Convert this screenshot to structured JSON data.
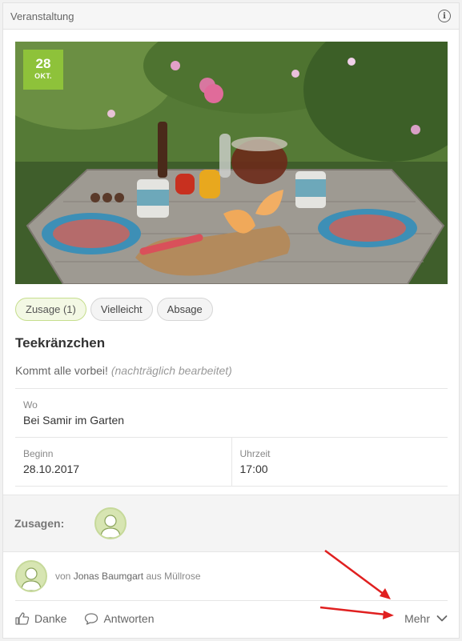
{
  "header": {
    "title": "Veranstaltung",
    "info_icon": "info-icon"
  },
  "event": {
    "date_day": "28",
    "date_month": "OKT.",
    "title": "Teekränzchen",
    "description": "Kommt alle vorbei!",
    "edited_note": "(nachträglich bearbeitet)"
  },
  "rsvp": {
    "accept": "Zusage (1)",
    "maybe": "Vielleicht",
    "decline": "Absage"
  },
  "details": {
    "where_label": "Wo",
    "where_value": "Bei Samir im Garten",
    "start_label": "Beginn",
    "start_value": "28.10.2017",
    "time_label": "Uhrzeit",
    "time_value": "17:00"
  },
  "accepts": {
    "label": "Zusagen:"
  },
  "author": {
    "prefix": "von",
    "name": "Jonas Baumgart",
    "connector": "aus",
    "place": "Müllrose"
  },
  "actions": {
    "like": "Danke",
    "reply": "Antworten",
    "more": "Mehr"
  },
  "colors": {
    "accent": "#8ec23a",
    "annotation": "#e02020"
  }
}
